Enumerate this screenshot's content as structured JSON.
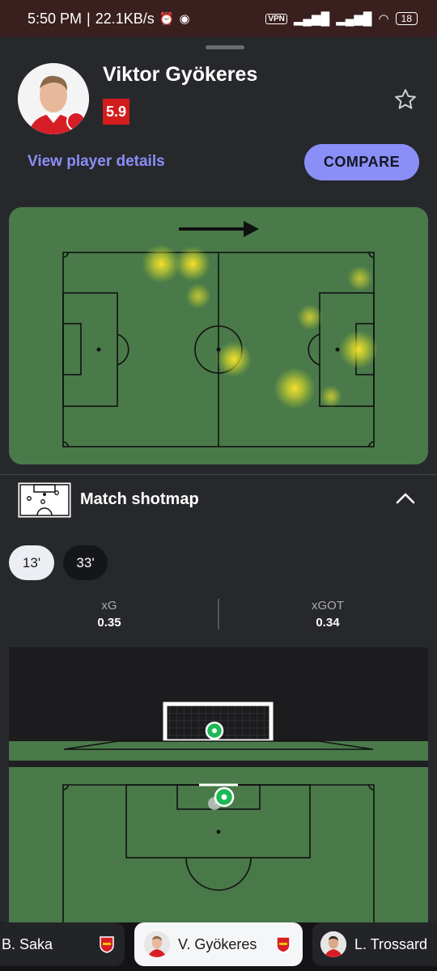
{
  "status_bar": {
    "time": "5:50 PM",
    "net_speed": "22.1KB/s",
    "vpn_label": "VPN",
    "battery": "18"
  },
  "header": {
    "player_name": "Viktor Gyökeres",
    "rating": "5.9",
    "view_details_label": "View player details",
    "compare_label": "COMPARE"
  },
  "shotmap": {
    "title": "Match shotmap",
    "chips": [
      "13'",
      "33'"
    ],
    "selected_chip": "13'",
    "xg_label": "xG",
    "xg_value": "0.35",
    "xgot_label": "xGOT",
    "xgot_value": "0.34"
  },
  "bottom_players": [
    "B. Saka",
    "V. Gyökeres",
    "L. Trossard"
  ],
  "colors": {
    "accent": "#8a8ff7",
    "rating_bg": "#d31c1c",
    "pitch": "#4a7a4a",
    "shot_marker": "#1db954"
  }
}
